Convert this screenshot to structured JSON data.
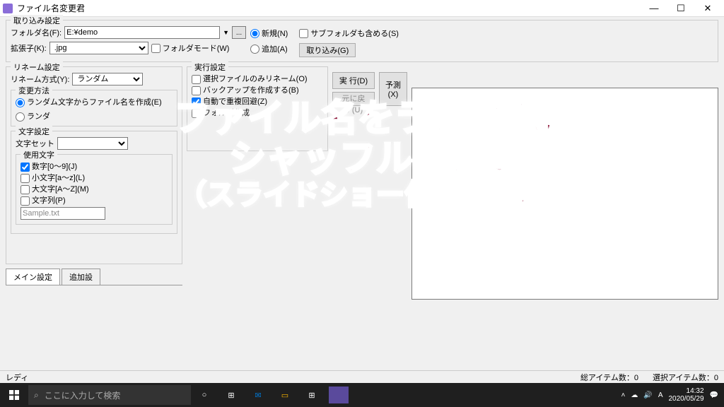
{
  "window": {
    "title": "ファイル名変更君",
    "minimize": "—",
    "maximize": "☐",
    "close": "✕"
  },
  "import": {
    "group_title": "取り込み設定",
    "folder_label": "フォルダ名(F):",
    "folder_value": "E:¥demo",
    "ext_label": "拡張子(K):",
    "ext_value": ".jpg",
    "folder_mode": "フォルダモード(W)",
    "radio_new": "新規(N)",
    "radio_add": "追加(A)",
    "subfolder": "サブフォルダも含める(S)",
    "import_btn": "取り込み(G)"
  },
  "rename": {
    "group_title": "リネーム設定",
    "method_label": "リネーム方式(Y):",
    "method_value": "ランダム",
    "change_method_title": "変更方法",
    "radio1": "ランダム文字からファイル名を作成(E)",
    "radio2": "ランダ",
    "char_settings_title": "文字設定",
    "charset_label": "文字セット",
    "use_chars_title": "使用文字",
    "chk_digits": "数字[0～9](J)",
    "chk_lower": "小文字[a～z](L)",
    "chk_upper": "大文字[A～Z](M)",
    "chk_string": "文字列(P)",
    "sample": "Sample.txt"
  },
  "exec": {
    "group_title": "実行設定",
    "chk1": "選択ファイルのみリネーム(O)",
    "chk2": "バックアップを作成する(B)",
    "chk3": "自動で重複回避(Z)",
    "chk4": "フォルダ作成",
    "btn_run": "実 行(D)",
    "btn_undo": "元に戻す(U)",
    "btn_predict": "予測(X)"
  },
  "tabs": {
    "main": "メイン設定",
    "extra": "追加設"
  },
  "status": {
    "ready": "レディ",
    "total_label": "総アイテム数：",
    "total_value": "0",
    "selected_label": "選択アイテム数：",
    "selected_value": "0"
  },
  "taskbar": {
    "search_placeholder": "ここに入力して検索",
    "time": "14:32",
    "date": "2020/05/29"
  },
  "overlay": {
    "line1": "ファイル名をランダムに",
    "line2": "シャッフルしたい",
    "line3": "（スライドショー作成などに）"
  }
}
